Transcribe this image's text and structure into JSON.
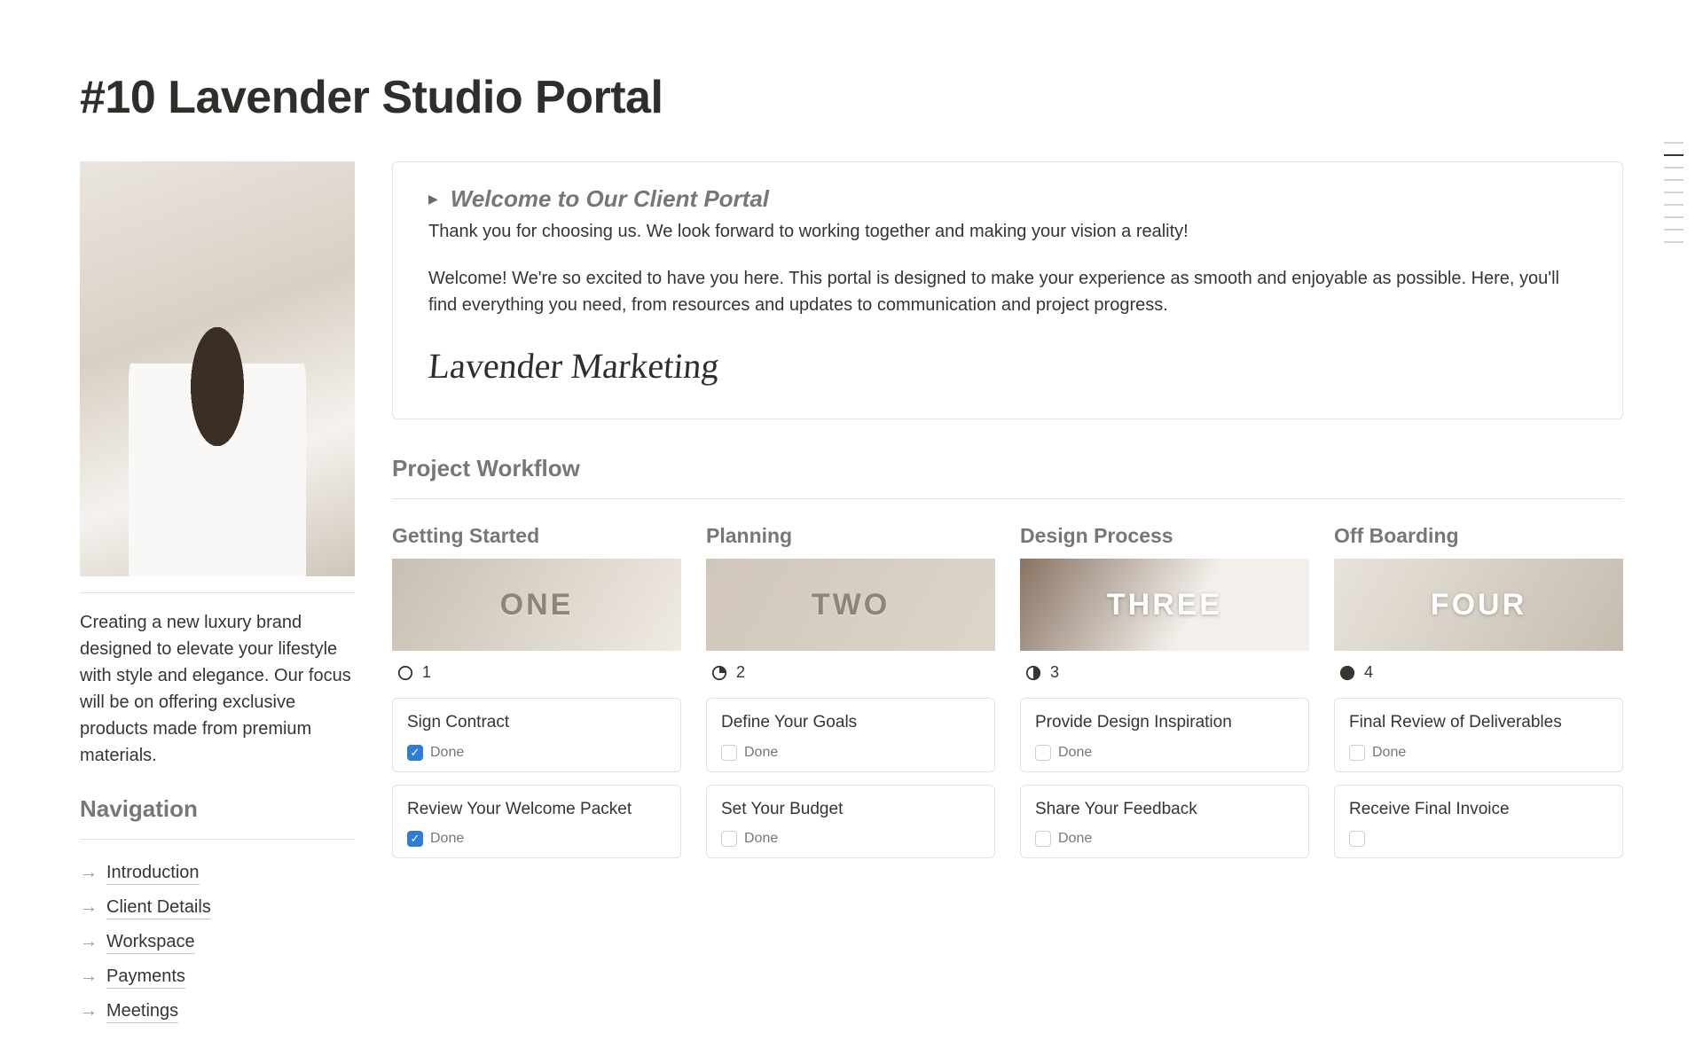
{
  "page": {
    "title": "#10 Lavender Studio Portal"
  },
  "sidebar": {
    "description": "Creating a new luxury brand designed to elevate your lifestyle with style and elegance. Our focus will be on offering exclusive products made from premium materials.",
    "nav_heading": "Navigation",
    "nav_items": [
      {
        "label": "Introduction"
      },
      {
        "label": "Client Details"
      },
      {
        "label": "Workspace"
      },
      {
        "label": "Payments"
      },
      {
        "label": "Meetings"
      }
    ]
  },
  "callout": {
    "title": "Welcome to Our Client Portal",
    "subtitle": "Thank you for choosing us. We look forward to working together and making your vision a reality!",
    "body": "Welcome! We're so excited to have you here. This portal is designed to make your experience as smooth and enjoyable as possible. Here, you'll find everything you need, from resources and updates to communication and project progress.",
    "signature": "Lavender Marketing"
  },
  "workflow": {
    "heading": "Project Workflow",
    "columns": [
      {
        "title": "Getting Started",
        "banner": "ONE",
        "progress_label": "1",
        "progress_fraction": 0,
        "tasks": [
          {
            "title": "Sign Contract",
            "done": true,
            "done_label": "Done"
          },
          {
            "title": "Review Your Welcome Packet",
            "done": true,
            "done_label": "Done"
          }
        ]
      },
      {
        "title": "Planning",
        "banner": "TWO",
        "progress_label": "2",
        "progress_fraction": 0.25,
        "tasks": [
          {
            "title": "Define Your Goals",
            "done": false,
            "done_label": "Done"
          },
          {
            "title": "Set Your Budget",
            "done": false,
            "done_label": "Done"
          }
        ]
      },
      {
        "title": "Design Process",
        "banner": "THREE",
        "progress_label": "3",
        "progress_fraction": 0.5,
        "tasks": [
          {
            "title": "Provide Design Inspiration",
            "done": false,
            "done_label": "Done"
          },
          {
            "title": "Share Your Feedback",
            "done": false,
            "done_label": "Done"
          }
        ]
      },
      {
        "title": "Off Boarding",
        "banner": "FOUR",
        "progress_label": "4",
        "progress_fraction": 1,
        "tasks": [
          {
            "title": "Final Review of Deliverables",
            "done": false,
            "done_label": "Done"
          },
          {
            "title": "Receive Final Invoice",
            "done": false,
            "done_label": ""
          }
        ]
      }
    ]
  }
}
